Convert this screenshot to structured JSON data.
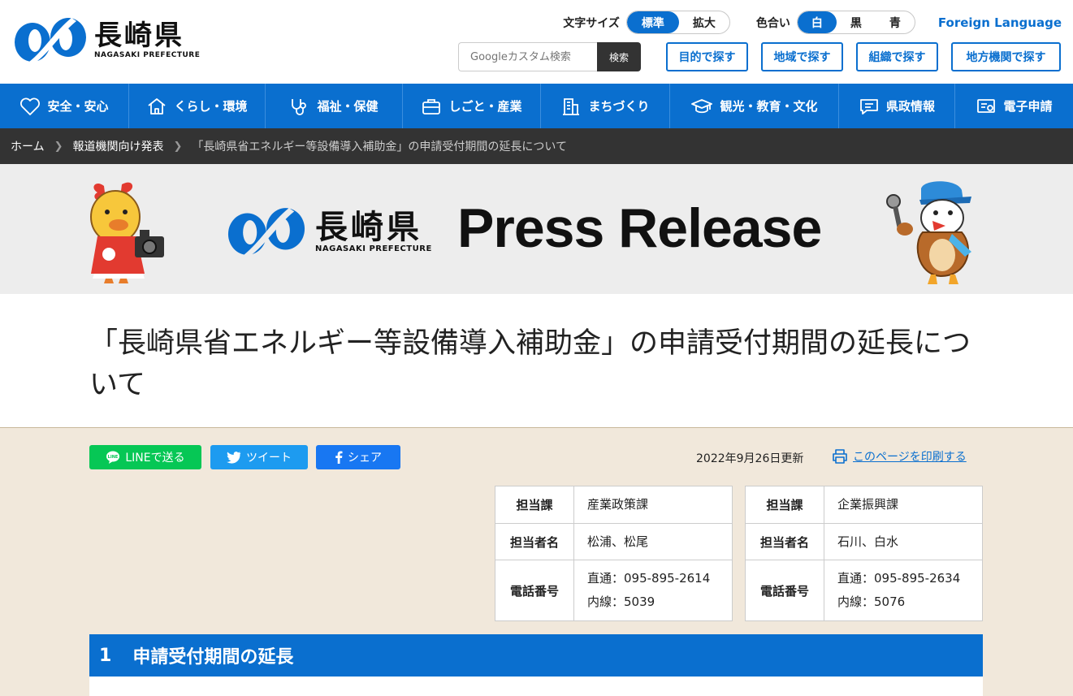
{
  "header": {
    "logo": {
      "main": "長崎県",
      "sub": "NAGASAKI PREFECTURE"
    },
    "font_size": {
      "label": "文字サイズ",
      "options": [
        "標準",
        "拡大"
      ],
      "selected": "標準"
    },
    "color_scheme": {
      "label": "色合い",
      "options": [
        "白",
        "黒",
        "青"
      ],
      "selected": "白"
    },
    "foreign_language": "Foreign Language",
    "search": {
      "placeholder": "Googleカスタム検索",
      "button": "検索"
    },
    "quick_links": [
      "目的で探す",
      "地域で探す",
      "組織で探す",
      "地方機関で探す"
    ]
  },
  "nav": [
    {
      "label": "安全・安心",
      "icon": "heart-icon"
    },
    {
      "label": "くらし・環境",
      "icon": "house-icon"
    },
    {
      "label": "福祉・保健",
      "icon": "stethoscope-icon"
    },
    {
      "label": "しごと・産業",
      "icon": "briefcase-icon"
    },
    {
      "label": "まちづくり",
      "icon": "building-icon"
    },
    {
      "label": "観光・教育・文化",
      "icon": "graduation-cap-icon"
    },
    {
      "label": "県政情報",
      "icon": "chat-icon"
    },
    {
      "label": "電子申請",
      "icon": "certificate-icon"
    }
  ],
  "breadcrumb": [
    "ホーム",
    "報道機関向け発表",
    "「長崎県省エネルギー等設備導入補助金」の申請受付期間の延長について"
  ],
  "banner": {
    "logo": {
      "main": "長崎県",
      "sub": "NAGASAKI PREFECTURE"
    },
    "headline": "Press Release"
  },
  "page": {
    "title": "「長崎県省エネルギー等設備導入補助金」の申請受付期間の延長について",
    "updated": "2022年9月26日更新",
    "print": "このページを印刷する"
  },
  "share": [
    {
      "label": "LINEで送る",
      "icon": "line-icon",
      "color": "#06c755"
    },
    {
      "label": "ツイート",
      "icon": "twitter-icon",
      "color": "#1d9bf0"
    },
    {
      "label": "シェア",
      "icon": "facebook-icon",
      "color": "#1877f2"
    }
  ],
  "contacts": [
    {
      "department_label": "担当課",
      "department": "産業政策課",
      "person_label": "担当者名",
      "person": "松浦、松尾",
      "phone_label": "電話番号",
      "direct": "直通：095-895-2614",
      "extension": "内線：5039"
    },
    {
      "department_label": "担当課",
      "department": "企業振興課",
      "person_label": "担当者名",
      "person": "石川、白水",
      "phone_label": "電話番号",
      "direct": "直通：095-895-2634",
      "extension": "内線：5076"
    }
  ],
  "section": {
    "number": "1",
    "title": "申請受付期間の延長"
  },
  "colors": {
    "primary": "#0a6fcf",
    "breadcrumb_bg": "#333333",
    "content_bg": "#f1e8db",
    "banner_bg": "#ededed"
  }
}
